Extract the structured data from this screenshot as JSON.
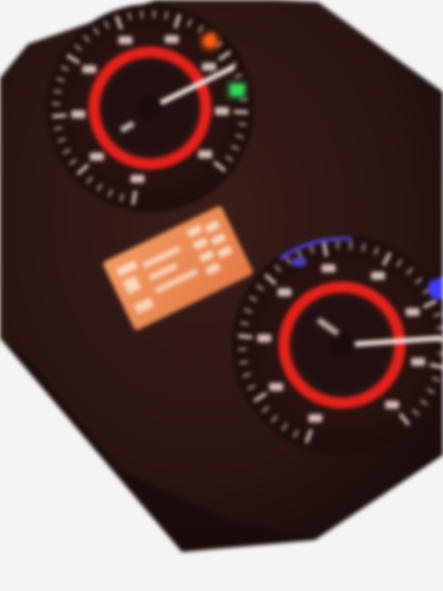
{
  "photo": {
    "subject": "",
    "background_color": "#f4f4f4",
    "panel_color": "#2a1512",
    "panel_shadow": "#120807",
    "ring_color": "#e5201b",
    "scale_color": "#f3ddd5",
    "needle_color": "#f6e8e2",
    "lcd_color": "#ec8a55",
    "lcd_text_color": "#fde8d8",
    "indicator_colors": {
      "amber": "#ff5a12",
      "green": "#2fdc58",
      "blue": "#3f3cff"
    }
  },
  "gauges": [
    {
      "id": "left",
      "needle_fraction": 0.78
    },
    {
      "id": "right",
      "needle_fraction": 0.82
    }
  ]
}
